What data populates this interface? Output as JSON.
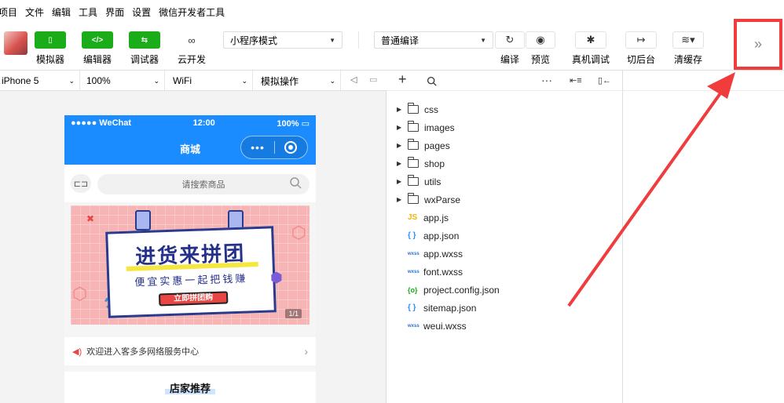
{
  "menubar": [
    "项目",
    "文件",
    "编辑",
    "工具",
    "界面",
    "设置",
    "微信开发者工具"
  ],
  "toolbar": {
    "simulator": "模拟器",
    "editor": "编辑器",
    "debugger": "调试器",
    "cloud": "云开发",
    "mode_select": "小程序模式",
    "compile_select": "普通编译",
    "compile": "编译",
    "preview": "预览",
    "real_debug": "真机调试",
    "background": "切后台",
    "clear_cache": "清缓存",
    "more": "»"
  },
  "subbar": {
    "device": "iPhone 5",
    "zoom": "100%",
    "network": "WiFi",
    "simulate": "模拟操作"
  },
  "phone": {
    "signal": "●●●●● WeChat",
    "time": "12:00",
    "battery": "100%",
    "nav_title": "商城",
    "capsule_dots": "•••",
    "search_placeholder": "请搜索商品",
    "banner_title": "进货来拼团",
    "banner_sub": "便宜实惠一起把钱赚",
    "banner_button": "立即拼团购",
    "banner_counter": "1/1",
    "notice": "欢迎进入客多多网络服务中心",
    "section_title": "店家推荐"
  },
  "explorer": {
    "folders": [
      "css",
      "images",
      "pages",
      "shop",
      "utils",
      "wxParse"
    ],
    "files": [
      {
        "name": "app.js",
        "icon": "JS"
      },
      {
        "name": "app.json",
        "icon": "{ }"
      },
      {
        "name": "app.wxss",
        "icon": "wxss"
      },
      {
        "name": "font.wxss",
        "icon": "wxss"
      },
      {
        "name": "project.config.json",
        "icon": "{o}"
      },
      {
        "name": "sitemap.json",
        "icon": "{ }"
      },
      {
        "name": "weui.wxss",
        "icon": "wxss"
      }
    ]
  },
  "colors": {
    "accent": "#1aad19",
    "nav": "#1a8cff",
    "highlight": "#f03c3c"
  }
}
